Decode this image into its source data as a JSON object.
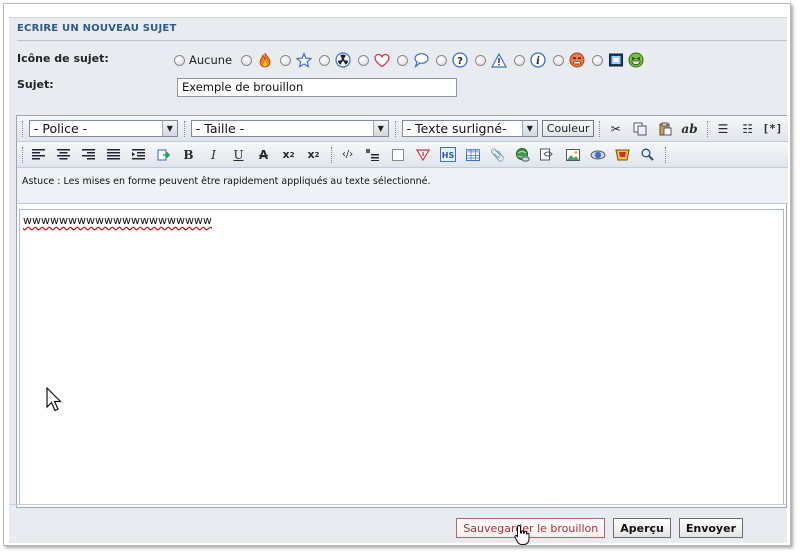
{
  "section": {
    "title": "ECRIRE UN NOUVEAU SUJET"
  },
  "form": {
    "icon_label": "Icône de sujet:",
    "icon_none_label": "Aucune",
    "icons": [
      "flame-icon",
      "star-icon",
      "radiation-icon",
      "heart-icon",
      "speech-bubble-icon",
      "question-icon",
      "warning-icon",
      "info-icon",
      "angry-face-icon",
      "tv-icon",
      "laughing-face-icon"
    ],
    "subject_label": "Sujet:",
    "subject_value": "Exemple de brouillon"
  },
  "editor": {
    "font_select": "- Police -",
    "size_select": "- Taille -",
    "highlight_select": "- Texte surligné-",
    "color_button": "Couleur",
    "tag_button": "[*]",
    "hint": "Astuce : Les mises en forme peuvent être rapidement appliqués au texte sélectionné.",
    "content": "wwwwwwwwwwwwwwwwwwwww"
  },
  "actions": {
    "save_draft": "Sauvegarder le brouillon",
    "preview": "Aperçu",
    "send": "Envoyer"
  },
  "colors": {
    "panel_bg": "#e8ecf1",
    "heading": "#2c5a8a",
    "draft_button_text": "#a8303c"
  }
}
